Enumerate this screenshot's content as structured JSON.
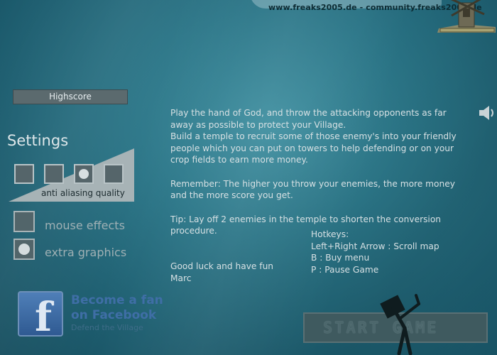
{
  "header": {
    "credit": "www.freaks2005.de - community.freaks2005.de"
  },
  "highscore_label": "Highscore",
  "settings": {
    "title": "Settings",
    "quality_label": "anti aliasing quality",
    "quality_level": 3,
    "quality_levels": 4,
    "options": [
      {
        "label": "mouse effects",
        "checked": false
      },
      {
        "label": "extra graphics",
        "checked": true
      }
    ]
  },
  "icons": {
    "speaker": "speaker-icon",
    "facebook": "facebook-icon",
    "windmill": "windmill-icon",
    "player": "stick-figure-icon"
  },
  "info": {
    "intro1": "Play the hand of God, and throw the attacking opponents as far away as possible to protect your Village.",
    "intro2": "Build a temple to recruit some of those enemy's into your friendly people which you can put on towers to help defending or on your crop fields to earn more money.",
    "remember": "Remember: The higher you throw your enemies, the more money and the more score you get.",
    "tip": "Tip: Lay off 2 enemies in the temple to shorten the conversion procedure.",
    "goodluck": "Good luck and have fun",
    "author": "Marc"
  },
  "hotkeys": {
    "title": "Hotkeys:",
    "lines": [
      "Left+Right Arrow : Scroll map",
      "B : Buy menu",
      "P : Pause Game"
    ]
  },
  "facebook": {
    "line1": "Become a fan",
    "line2": "on Facebook",
    "subtitle": "Defend the Village"
  },
  "start_button": {
    "label": "START GAME"
  }
}
